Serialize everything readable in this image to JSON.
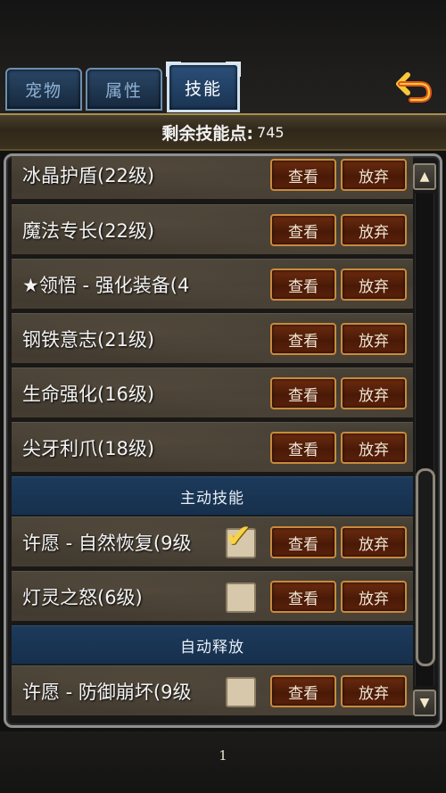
{
  "tabs": [
    {
      "label": "宠物"
    },
    {
      "label": "属性"
    },
    {
      "label": "技能"
    }
  ],
  "back_icon": "back-arrow-icon",
  "header": {
    "label": "剩余技能点:",
    "points": "745"
  },
  "buttons": {
    "view": "查看",
    "drop": "放弃"
  },
  "skills_passive": [
    {
      "name": "冰晶护盾(22级)"
    },
    {
      "name": "魔法专长(22级)"
    },
    {
      "name": "★领悟 - 强化装备(4"
    },
    {
      "name": "钢铁意志(21级)"
    },
    {
      "name": "生命强化(16级)"
    },
    {
      "name": "尖牙利爪(18级)"
    }
  ],
  "sections": {
    "active": "主动技能",
    "auto": "自动释放"
  },
  "skills_active": [
    {
      "name": "许愿 - 自然恢复(9级",
      "checked": true
    },
    {
      "name": "灯灵之怒(6级)",
      "checked": false
    }
  ],
  "skills_auto": [
    {
      "name": "许愿 - 防御崩坏(9级",
      "checked": false
    }
  ],
  "scroll": {
    "up_icon": "triangle-up-icon",
    "down_icon": "triangle-down-icon"
  },
  "page": "1",
  "colors": {
    "accent_gold": "#c98a3c",
    "tab_blue": "#2a4766",
    "section_blue": "#1d3a5b",
    "button_brown": "#5a210b"
  }
}
